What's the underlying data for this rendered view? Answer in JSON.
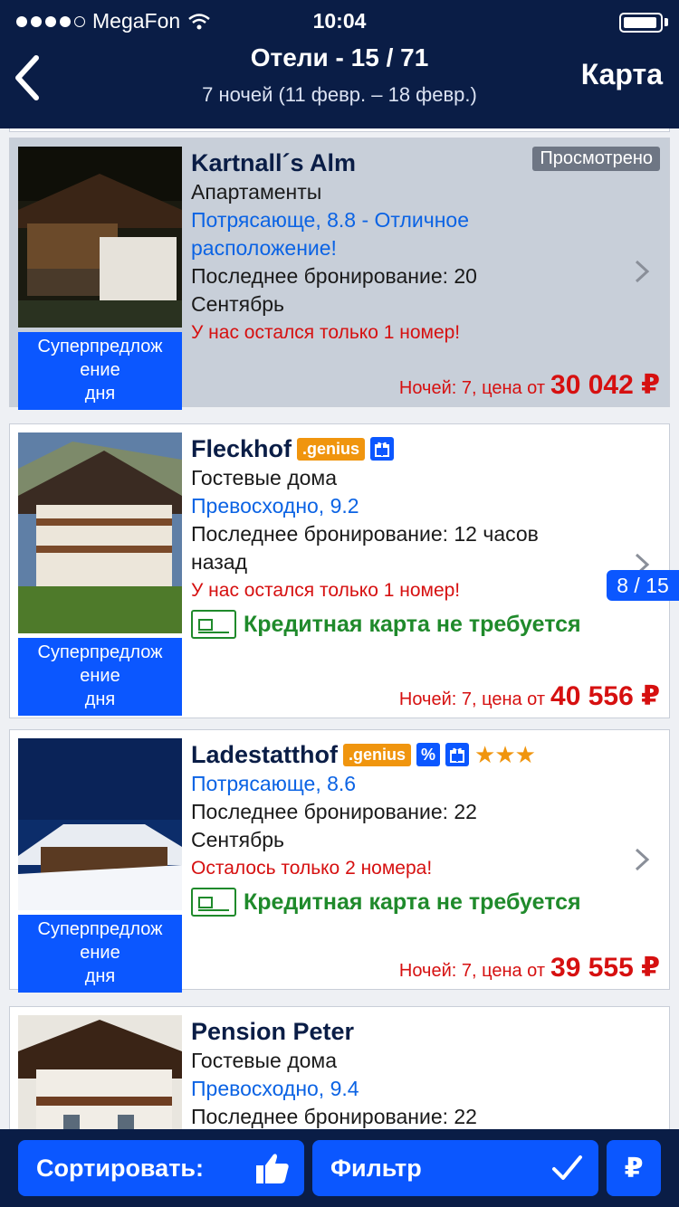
{
  "status": {
    "carrier": "MegaFon",
    "time": "10:04"
  },
  "header": {
    "title": "Отели - 15 / 71",
    "subtitle": "7 ночей (11 февр. – 18 февр.)",
    "map_label": "Карта"
  },
  "hotels": [
    {
      "name": "Kartnall´s Alm",
      "viewed_badge": "Просмотрено",
      "type": "Апартаменты",
      "rating_line1": "Потрясающе, 8.8 - Отличное",
      "rating_line2": "расположение!",
      "booking_line1": "Последнее бронирование: 20",
      "booking_line2": "Сентябрь",
      "urgency": "У нас остался только 1 номер!",
      "deal_line1": "Суперпредлож",
      "deal_line2": "ение",
      "deal_line3": "дня",
      "price_prefix": "Ночей: 7, цена от",
      "price": "30 042 ₽"
    },
    {
      "name": "Fleckhof",
      "genius": ".genius",
      "type": "Гостевые дома",
      "rating": "Превосходно, 9.2",
      "booking_line1": "Последнее бронирование: 12  часов",
      "booking_line2": "назад",
      "urgency": "У нас остался только 1 номер!",
      "credit": "Кредитная карта не требуется",
      "deal_line1": "Суперпредлож",
      "deal_line2": "ение",
      "deal_line3": "дня",
      "price_prefix": "Ночей: 7, цена от",
      "price": "40 556 ₽"
    },
    {
      "name": "Ladestatthof",
      "genius": ".genius",
      "discount": "%",
      "stars": "★★★",
      "rating": "Потрясающе, 8.6",
      "booking_line1": "Последнее бронирование: 22",
      "booking_line2": "Сентябрь",
      "urgency": "Осталось только 2 номера!",
      "credit": "Кредитная карта не требуется",
      "deal_line1": "Суперпредлож",
      "deal_line2": "ение",
      "deal_line3": "дня",
      "price_prefix": "Ночей: 7, цена от",
      "price": "39 555 ₽"
    },
    {
      "name": "Pension Peter",
      "type": "Гостевые дома",
      "rating": "Превосходно, 9.4",
      "booking_line1": "Последнее бронирование: 22"
    }
  ],
  "page_indicator": "8 / 15",
  "bottom": {
    "sort_label": "Сортировать:",
    "filter_label": "Фильтр",
    "currency_label": "₽"
  },
  "colors": {
    "navy": "#0a1d46",
    "brand_blue": "#0b57ff",
    "rating_blue": "#0b63e4",
    "urgent_red": "#d61010",
    "credit_green": "#1f8a2b",
    "genius_orange": "#f0950e"
  }
}
